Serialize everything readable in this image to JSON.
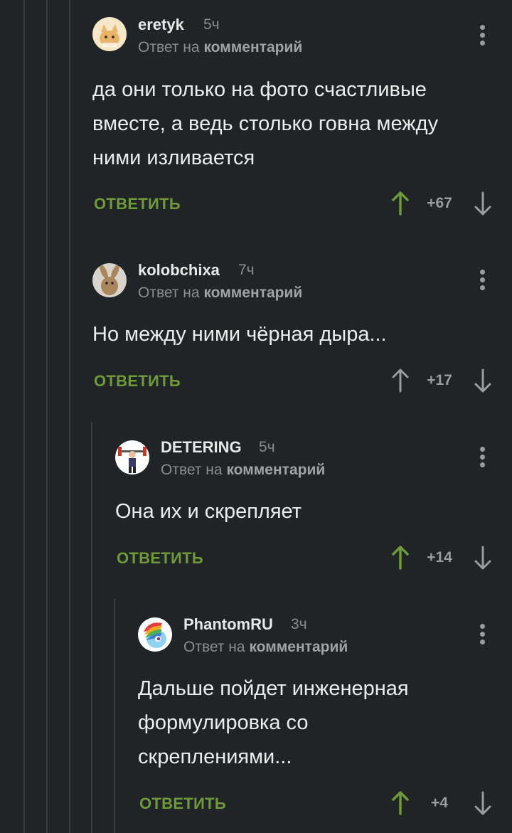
{
  "reply_prefix": "Ответ на",
  "reply_target": "комментарий",
  "reply_label": "ОТВЕТИТЬ",
  "colors": {
    "background": "#212426",
    "reply_green": "#6e9a3a",
    "upvoted": "#6e9a3a",
    "muted": "#8a8d90"
  },
  "comments": [
    {
      "author": "eretyk",
      "time": "5ч",
      "avatar_icon": "cat-avatar-icon",
      "lines": [
        "да они только на фото счастливые",
        "вместе, а ведь столько говна между",
        "ними изливается"
      ],
      "score": "+67",
      "upvoted": true
    },
    {
      "author": "kolobchixa",
      "time": "7ч",
      "avatar_icon": "rabbit-avatar-icon",
      "lines": [
        "Но между ними чёрная дыра..."
      ],
      "score": "+17",
      "upvoted": false
    },
    {
      "author": "DETERING",
      "time": "5ч",
      "avatar_icon": "weightlifter-avatar-icon",
      "lines": [
        "Она их и скрепляет"
      ],
      "score": "+14",
      "upvoted": true
    },
    {
      "author": "PhantomRU",
      "time": "3ч",
      "avatar_icon": "pony-avatar-icon",
      "lines": [
        "Дальше пойдет инженерная",
        "формулировка со",
        "скреплениями..."
      ],
      "score": "+4",
      "upvoted": true
    }
  ]
}
